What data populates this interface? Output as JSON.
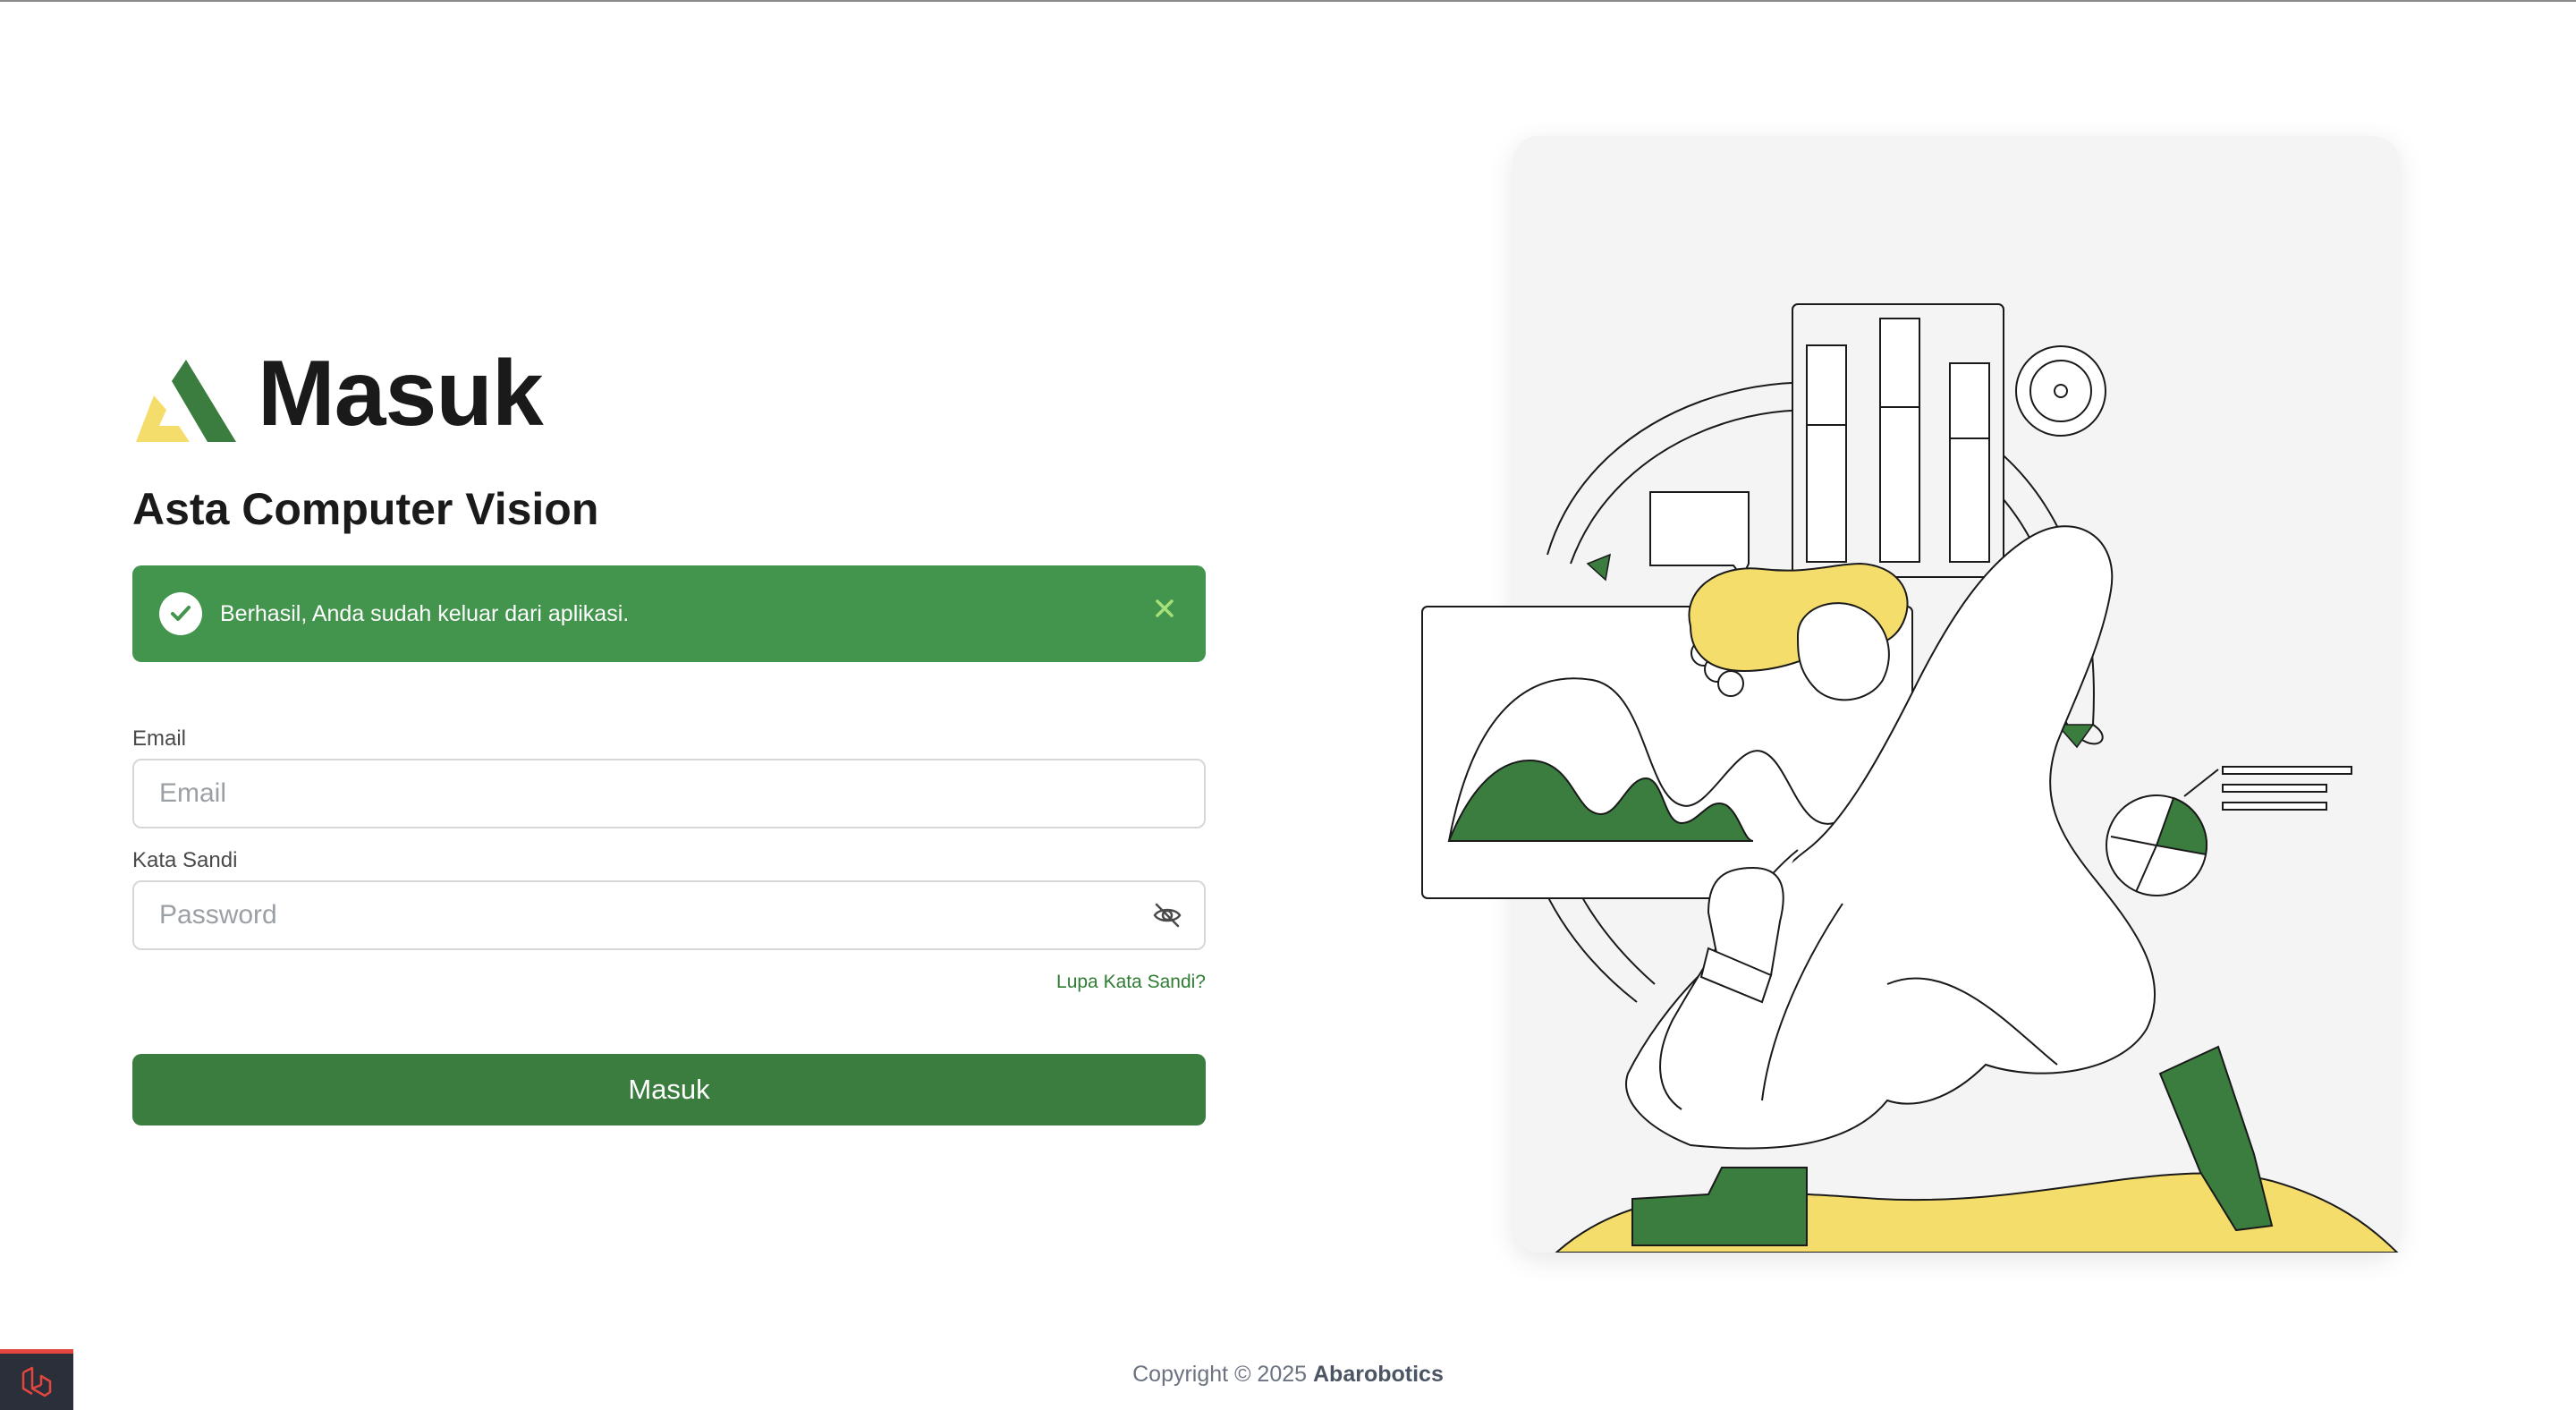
{
  "brand": {
    "title": "Masuk",
    "logo_icon": "asta-logo-icon"
  },
  "app": {
    "subtitle": "Asta Computer Vision"
  },
  "alert": {
    "message": "Berhasil, Anda sudah keluar dari aplikasi.",
    "icon": "check-circle-icon",
    "close_icon": "close-icon"
  },
  "form": {
    "email": {
      "label": "Email",
      "placeholder": "Email",
      "value": ""
    },
    "password": {
      "label": "Kata Sandi",
      "placeholder": "Password",
      "value": "",
      "toggle_icon": "eye-off-icon"
    },
    "forgot_label": "Lupa Kata Sandi?",
    "submit_label": "Masuk"
  },
  "footer": {
    "text": "Copyright © 2025",
    "company": "Abarobotics"
  },
  "colors": {
    "primary": "#3a7d3f",
    "alert": "#43944d",
    "accent_yellow": "#f5dd6b",
    "card_bg": "#f4f4f4"
  }
}
